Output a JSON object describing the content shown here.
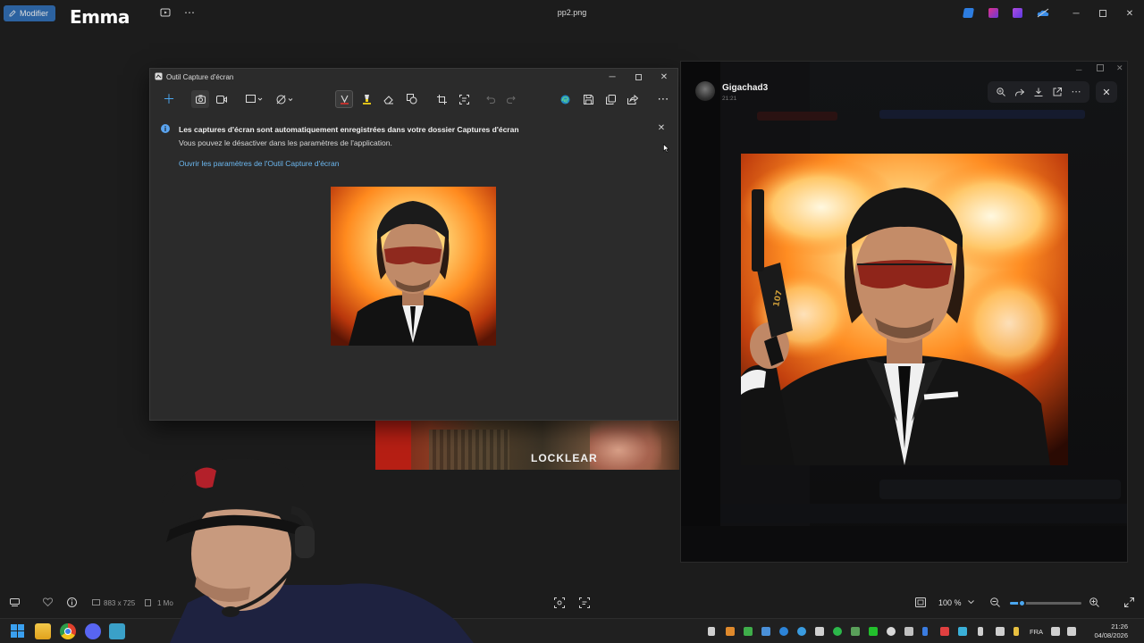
{
  "viewer": {
    "edit_button": "Modifier",
    "logo": "Emma",
    "file_name": "pp2.png",
    "status": {
      "dimensions": "883 x 725",
      "file_size": "1 Mo",
      "zoom": "100 %",
      "zoom_fraction": 0.16
    }
  },
  "snipping_tool": {
    "title": "Outil Capture d'écran",
    "notice": {
      "title": "Les captures d'écran sont automatiquement enregistrées dans votre dossier Captures d'écran",
      "body": "Vous pouvez le désactiver dans les paramètres de l'application.",
      "link": "Ouvrir les paramètres de l'Outil Capture d'écran"
    },
    "toolbar_icons": [
      "new-icon",
      "camera-icon",
      "video-icon",
      "rectangle-mode-icon",
      "delay-icon",
      "pen-icon",
      "highlighter-icon",
      "eraser-icon",
      "shapes-icon",
      "crop-icon",
      "text-actions-icon",
      "undo-icon",
      "redo-icon",
      "edge-icon",
      "save-icon",
      "copy-icon",
      "share-icon",
      "more-icon"
    ]
  },
  "background_image": {
    "label": "LOCKLEAR"
  },
  "image_viewer": {
    "username": "Gigachad3",
    "time": "21:21",
    "gun_marking": "107",
    "tools": [
      "zoom-icon",
      "forward-icon",
      "download-icon",
      "open-external-icon",
      "more-icon"
    ]
  },
  "taskbar": {
    "language": "FRA",
    "time": "21:26",
    "date": "04/08/2026"
  },
  "colors": {
    "accent": "#4aa6ef",
    "edit_button": "#2f6fb8",
    "fire_orange": "#ff7a10",
    "dark_bg": "#1c1c1c"
  }
}
